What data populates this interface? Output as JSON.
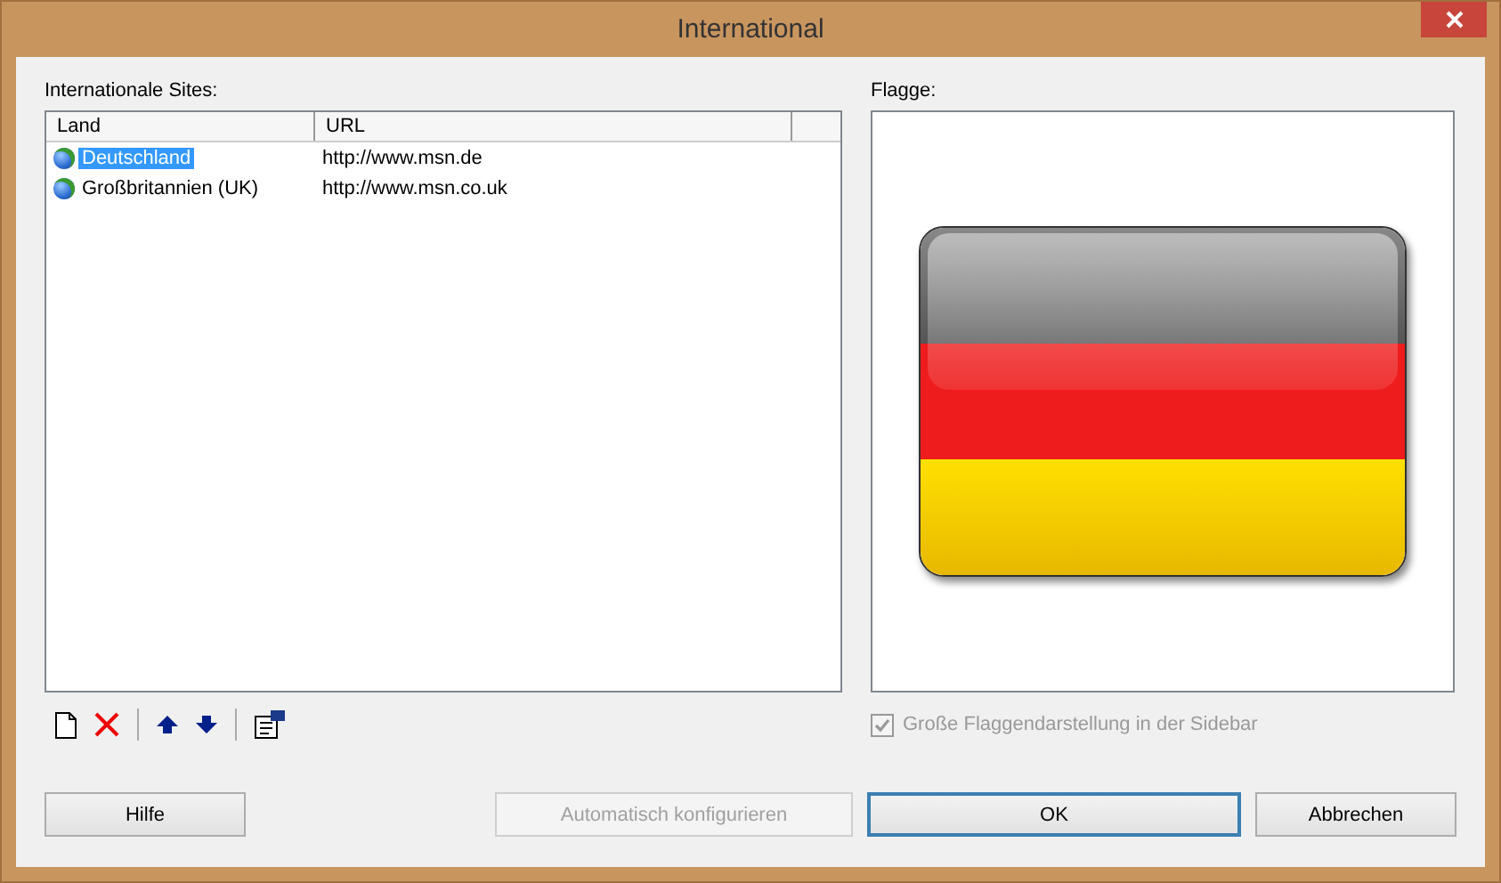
{
  "window": {
    "title": "International"
  },
  "sites": {
    "label": "Internationale Sites:",
    "columns": [
      "Land",
      "URL"
    ],
    "rows": [
      {
        "land": "Deutschland",
        "url": "http://www.msn.de",
        "selected": true
      },
      {
        "land": "Großbritannien (UK)",
        "url": "http://www.msn.co.uk",
        "selected": false
      }
    ]
  },
  "flag": {
    "label": "Flagge:",
    "checkbox": {
      "label": "Große Flaggendarstellung in der Sidebar",
      "checked": true,
      "disabled": true
    }
  },
  "buttons": [
    {
      "label": "Hilfe",
      "disabled": false,
      "default": false
    },
    {
      "label": "Automatisch konfigurieren",
      "disabled": true,
      "default": false
    },
    {
      "label": "OK",
      "disabled": false,
      "default": true
    },
    {
      "label": "Abbrechen",
      "disabled": false,
      "default": false
    }
  ]
}
